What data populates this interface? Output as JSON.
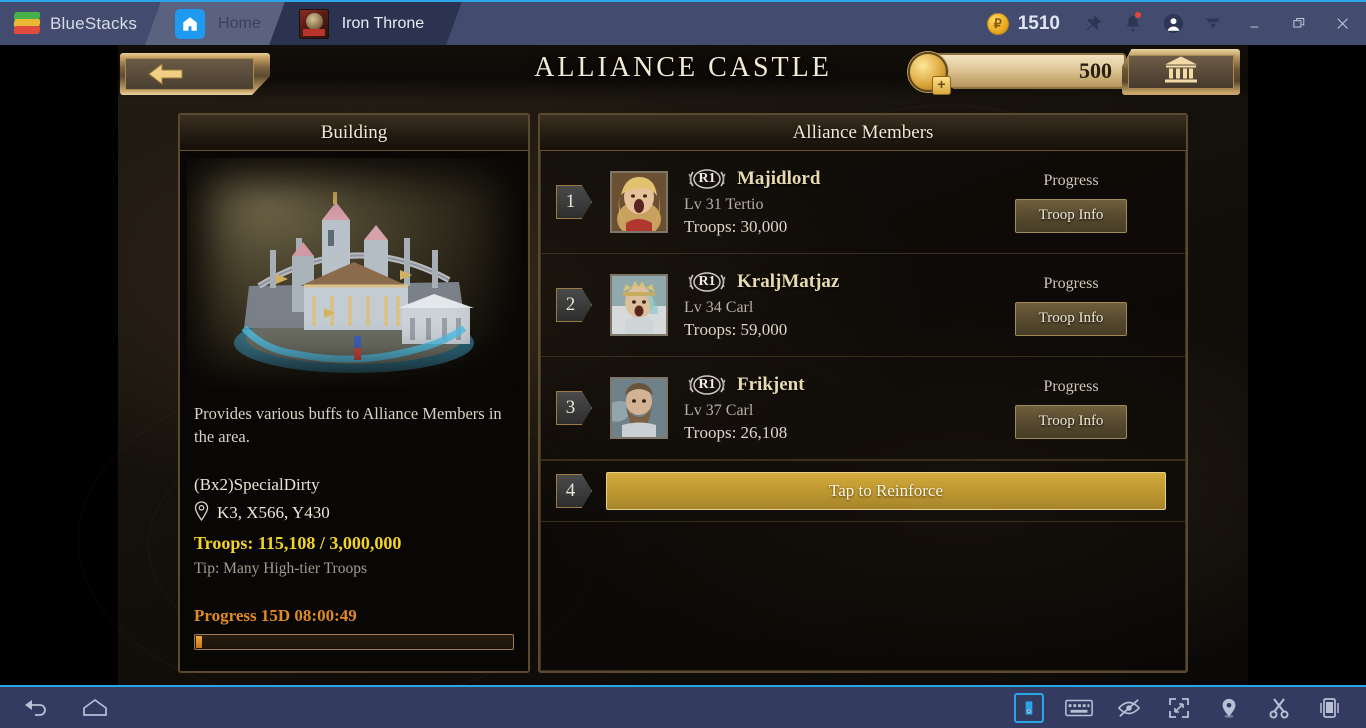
{
  "bluestacks": {
    "brand": "BlueStacks",
    "tabs": [
      {
        "label": "Home",
        "icon": "home-icon",
        "active": false
      },
      {
        "label": "Iron Throne",
        "icon": "game-icon",
        "active": true
      }
    ],
    "points": "1510",
    "point_symbol": "₽",
    "right_icons": [
      "pin-icon",
      "bell-icon",
      "account-icon",
      "chevron-down-icon"
    ],
    "window_controls": [
      "minimize-icon",
      "restore-icon",
      "close-icon"
    ],
    "bottom_left_icons": [
      "back-icon",
      "home-icon"
    ],
    "bottom_right_icons": [
      "phone-icon",
      "keyboard-icon",
      "eye-off-icon",
      "fullscreen-icon",
      "location-icon",
      "scissors-icon",
      "shake-icon"
    ]
  },
  "game": {
    "title": "ALLIANCE CASTLE",
    "back_button": "back-arrow-icon",
    "currency": "500",
    "vault_icon": "bank-icon",
    "building": {
      "panel_title": "Building",
      "description": "Provides various buffs to Alliance Members in the area.",
      "name": "(Bx2)SpecialDirty",
      "coordinates": "K3, X566, Y430",
      "troops": "Troops: 115,108 / 3,000,000",
      "tip": "Tip: Many High-tier Troops",
      "progress_label": "Progress 15D 08:00:49",
      "progress_percent": 2
    },
    "members": {
      "panel_title": "Alliance Members",
      "progress_label": "Progress",
      "troop_info_label": "Troop Info",
      "reinforce_label": "Tap to Reinforce",
      "reinforce_index": "4",
      "rows": [
        {
          "index": "1",
          "rank": "R1",
          "name": "Majidlord",
          "level": "Lv 31 Tertio",
          "troops": "Troops: 30,000",
          "avatar_tone": "#b98a4e"
        },
        {
          "index": "2",
          "rank": "R1",
          "name": "KraljMatjaz",
          "level": "Lv 34 Carl",
          "troops": "Troops: 59,000",
          "avatar_tone": "#8fa3a8"
        },
        {
          "index": "3",
          "rank": "R1",
          "name": "Frikjent",
          "level": "Lv 37 Carl",
          "troops": "Troops: 26,108",
          "avatar_tone": "#6d7d86"
        }
      ]
    }
  },
  "colors": {
    "accent_blue": "#2aa6e8",
    "titlebar": "#434c6e",
    "gold": "#c9a55e",
    "troops_yellow": "#f2d32a",
    "progress_orange": "#e08a24"
  }
}
